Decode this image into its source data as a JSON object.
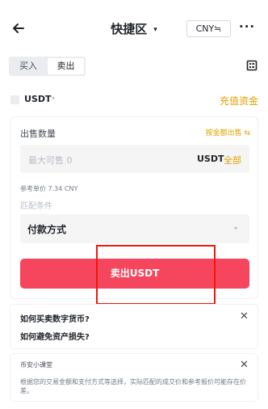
{
  "header": {
    "title": "快捷区",
    "title_caret": "▾",
    "currency_label": "CNY≒",
    "more_label": "···"
  },
  "tabs": [
    {
      "label": "买入",
      "active": false
    },
    {
      "label": "卖出",
      "active": true
    }
  ],
  "asset": {
    "symbol": "USDT",
    "caret": "▾",
    "deposit_label": "充值资金"
  },
  "form": {
    "quantity_label": "出售数量",
    "by_amount_label": "按金额出售 ⇆",
    "quantity_placeholder": "最大可售 0",
    "quantity_unit": "USDT",
    "all_label": "全部",
    "reference_price": "参考单价 7.34 CNY",
    "match_label": "匹配条件",
    "payment_label": "付款方式",
    "payment_caret": "▾",
    "sell_button": "卖出USDT"
  },
  "faq": {
    "q1": "如何买卖数字货币?",
    "q2": "如何避免资产损失?",
    "close": "✕"
  },
  "tips": {
    "title": "币安小课堂",
    "close": "✕",
    "text": "根据您的交易金额和支付方式等选择，实际匹配的成交价和参考报价可能存在价差。"
  },
  "colors": {
    "accent": "#e0a200",
    "sell_button": "#f5465d",
    "highlight_box": "#f2170b"
  }
}
